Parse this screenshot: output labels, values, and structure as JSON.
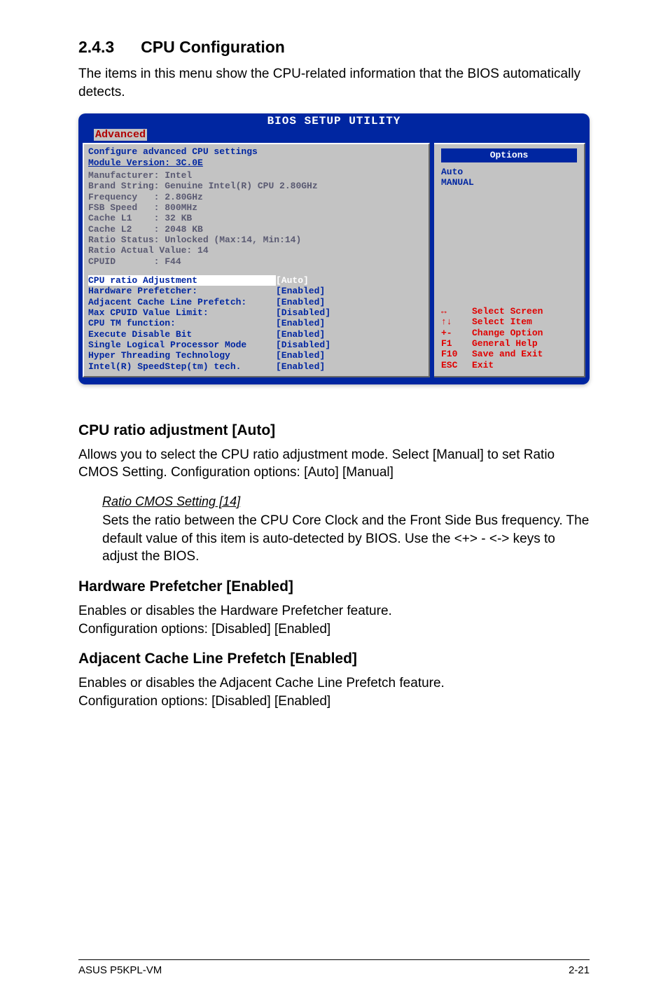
{
  "section": {
    "number": "2.4.3",
    "title": "CPU Configuration"
  },
  "intro": "The items in this menu show the CPU-related information that the BIOS automatically detects.",
  "bios": {
    "title": "BIOS SETUP UTILITY",
    "active_tab": "Advanced",
    "left_header_l1": "Configure advanced CPU settings",
    "left_header_l2": "Module Version: 3C.0E",
    "cpu_info": [
      "Manufacturer: Intel",
      "Brand String: Genuine Intel(R) CPU 2.80GHz",
      "Frequency   : 2.80GHz",
      "FSB Speed   : 800MHz",
      "Cache L1    : 32 KB",
      "Cache L2    : 2048 KB",
      "Ratio Status: Unlocked (Max:14, Min:14)",
      "Ratio Actual Value: 14",
      "CPUID       : F44"
    ],
    "params": [
      {
        "label": "CPU ratio Adjustment",
        "value": "[Auto]",
        "hl": true
      },
      {
        "label": "Hardware Prefetcher:",
        "value": "[Enabled]",
        "hl": false
      },
      {
        "label": "Adjacent Cache Line Prefetch:",
        "value": "[Enabled]",
        "hl": false
      },
      {
        "label": "Max CPUID Value Limit:",
        "value": "[Disabled]",
        "hl": false
      },
      {
        "label": "CPU TM function:",
        "value": "[Enabled]",
        "hl": false
      },
      {
        "label": "Execute Disable Bit",
        "value": "[Enabled]",
        "hl": false
      },
      {
        "label": "Single Logical Processor Mode",
        "value": "[Disabled]",
        "hl": false
      },
      {
        "label": "Hyper Threading Technology",
        "value": "[Enabled]",
        "hl": false
      },
      {
        "label": "Intel(R) SpeedStep(tm) tech.",
        "value": "[Enabled]",
        "hl": false
      }
    ],
    "right": {
      "header": "Options",
      "options": [
        "Auto",
        "MANUAL"
      ],
      "nav": [
        {
          "key": "↔",
          "label": "Select Screen"
        },
        {
          "key": "↑↓",
          "label": "Select Item"
        },
        {
          "key": "+-",
          "label": "Change Option"
        },
        {
          "key": "F1",
          "label": "General Help"
        },
        {
          "key": "F10",
          "label": "Save and Exit"
        },
        {
          "key": "ESC",
          "label": "Exit"
        }
      ]
    }
  },
  "s1": {
    "h": "CPU ratio adjustment [Auto]",
    "p": "Allows you to select the CPU ratio adjustment mode. Select [Manual] to set Ratio CMOS Setting. Configuration options: [Auto] [Manual]",
    "sub_h": "Ratio CMOS Setting [14]",
    "sub_p": "Sets the ratio between the CPU Core Clock and the Front Side Bus frequency. The default value of this item is auto-detected by BIOS. Use the <+> - <-> keys to adjust the BIOS."
  },
  "s2": {
    "h": "Hardware Prefetcher [Enabled]",
    "p1": "Enables or disables the Hardware Prefetcher feature.",
    "p2": "Configuration options: [Disabled] [Enabled]"
  },
  "s3": {
    "h": "Adjacent Cache Line Prefetch [Enabled]",
    "p1": "Enables or disables the Adjacent Cache Line Prefetch feature.",
    "p2": "Configuration options: [Disabled] [Enabled]"
  },
  "footer": {
    "left": "ASUS P5KPL-VM",
    "right": "2-21"
  }
}
